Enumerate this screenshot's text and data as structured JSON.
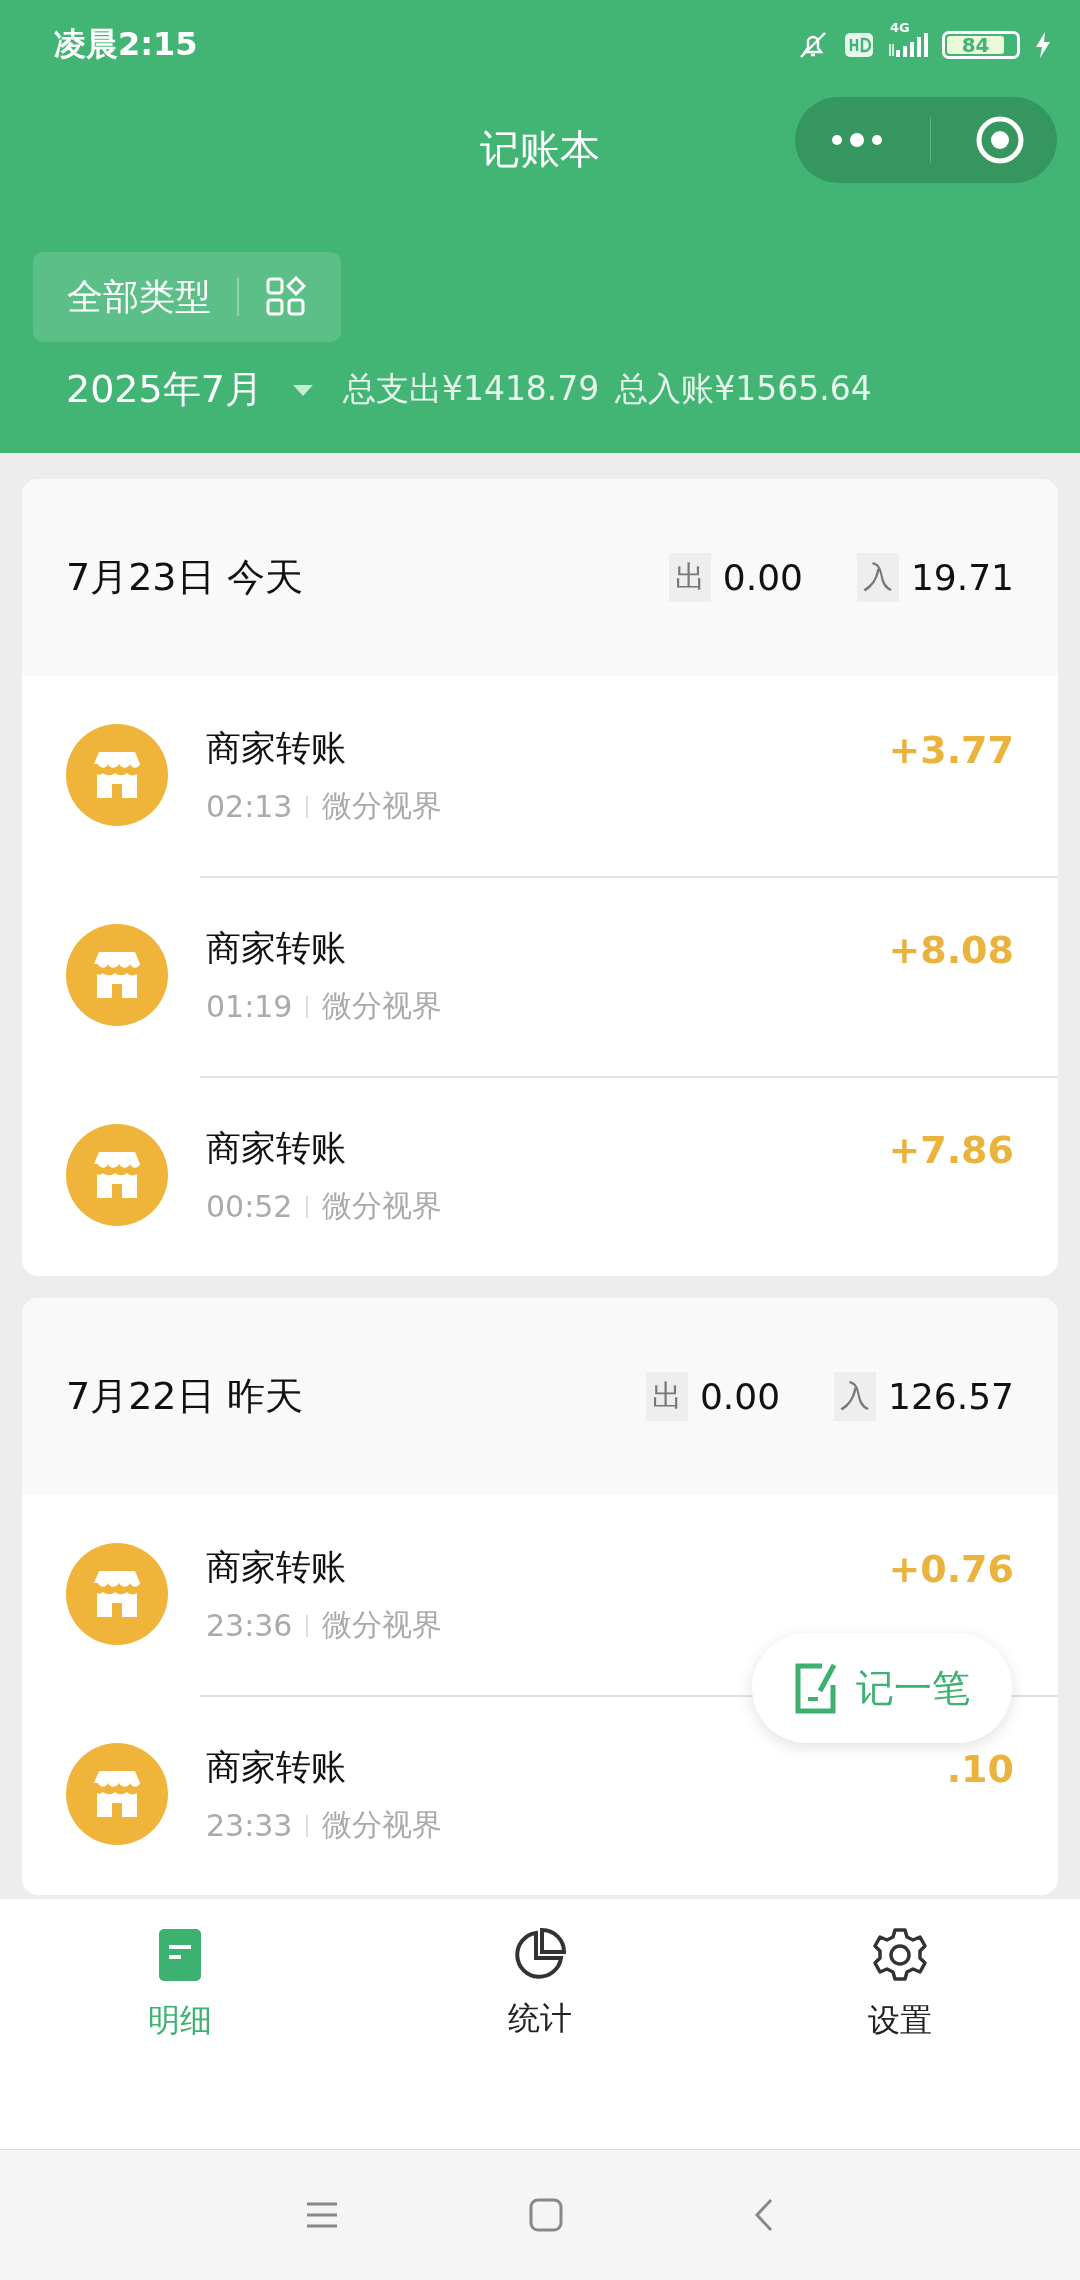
{
  "status_bar": {
    "time": "凌晨2:15",
    "network": "4G",
    "battery": "84"
  },
  "title": "记账本",
  "filter": {
    "label": "全部类型"
  },
  "summary": {
    "month": "2025年7月",
    "expense": "总支出¥1418.79",
    "income": "总入账¥1565.64"
  },
  "days": [
    {
      "date": "7月23日 今天",
      "expense_tag": "出",
      "expense": "0.00",
      "income_tag": "入",
      "income": "19.71",
      "entries": [
        {
          "title": "商家转账",
          "time": "02:13",
          "merchant": "微分视界",
          "amount": "+3.77"
        },
        {
          "title": "商家转账",
          "time": "01:19",
          "merchant": "微分视界",
          "amount": "+8.08"
        },
        {
          "title": "商家转账",
          "time": "00:52",
          "merchant": "微分视界",
          "amount": "+7.86"
        }
      ]
    },
    {
      "date": "7月22日 昨天",
      "expense_tag": "出",
      "expense": "0.00",
      "income_tag": "入",
      "income": "126.57",
      "entries": [
        {
          "title": "商家转账",
          "time": "23:36",
          "merchant": "微分视界",
          "amount": "+0.76"
        },
        {
          "title": "商家转账",
          "time": "23:33",
          "merchant": "微分视界",
          "amount": ".10"
        }
      ]
    }
  ],
  "fab": {
    "label": "记一笔"
  },
  "tabs": [
    {
      "kind": "details",
      "label": "明细",
      "selected": true
    },
    {
      "kind": "stats",
      "label": "统计",
      "selected": false
    },
    {
      "kind": "settings",
      "label": "设置",
      "selected": false
    }
  ]
}
